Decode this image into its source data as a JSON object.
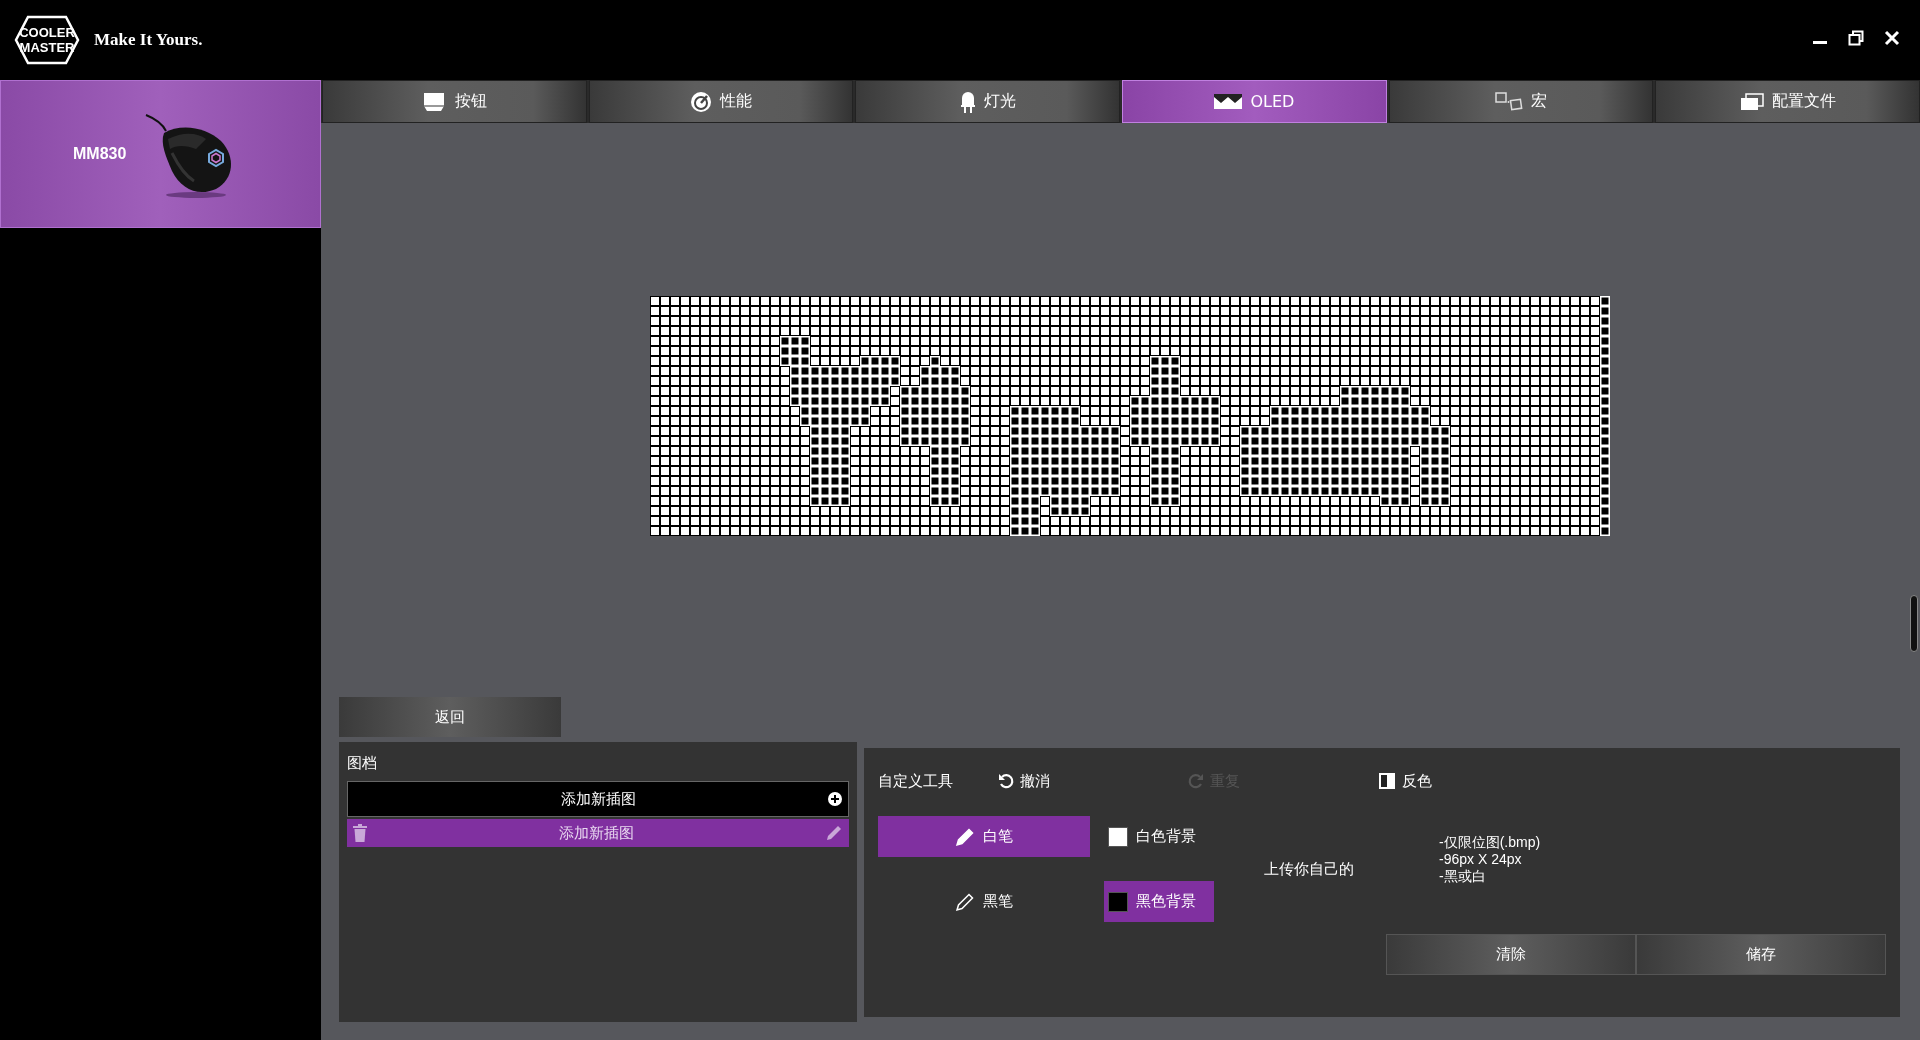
{
  "app": {
    "logo_lines": [
      "COOLER",
      "MASTER"
    ],
    "tagline": "Make It Yours."
  },
  "device": {
    "name": "MM830",
    "selected": true
  },
  "tabs": [
    {
      "label": "按钮",
      "kind": "keycap",
      "selected": false
    },
    {
      "label": "性能",
      "kind": "gauge",
      "selected": false
    },
    {
      "label": "灯光",
      "kind": "bulb",
      "selected": false
    },
    {
      "label": "OLED",
      "kind": "oled",
      "selected": true
    },
    {
      "label": "宏",
      "kind": "macro",
      "selected": false
    },
    {
      "label": "配置文件",
      "kind": "profile",
      "selected": false
    }
  ],
  "back_button": "返回",
  "gallery": {
    "title": "图档",
    "add_item": "添加新插图",
    "items": [
      {
        "label": "添加新插图",
        "selected": true
      }
    ]
  },
  "tools": {
    "title": "自定义工具",
    "undo": {
      "label": "撤消",
      "disabled": false
    },
    "redo": {
      "label": "重复",
      "disabled": true
    },
    "invert": "反色",
    "pens": [
      {
        "label": "白笔",
        "selected": true
      },
      {
        "label": "黑笔",
        "selected": false
      }
    ],
    "backgrounds": [
      {
        "label": "白色背景",
        "selected": false,
        "color": "#ffffff"
      },
      {
        "label": "黑色背景",
        "selected": true,
        "color": "#000000"
      }
    ],
    "upload": {
      "label": "上传你自己的",
      "notes": [
        "-仅限位图(.bmp)",
        "-96px X 24px",
        "-黑或白"
      ]
    },
    "buttons": [
      "清除",
      "储存"
    ]
  }
}
